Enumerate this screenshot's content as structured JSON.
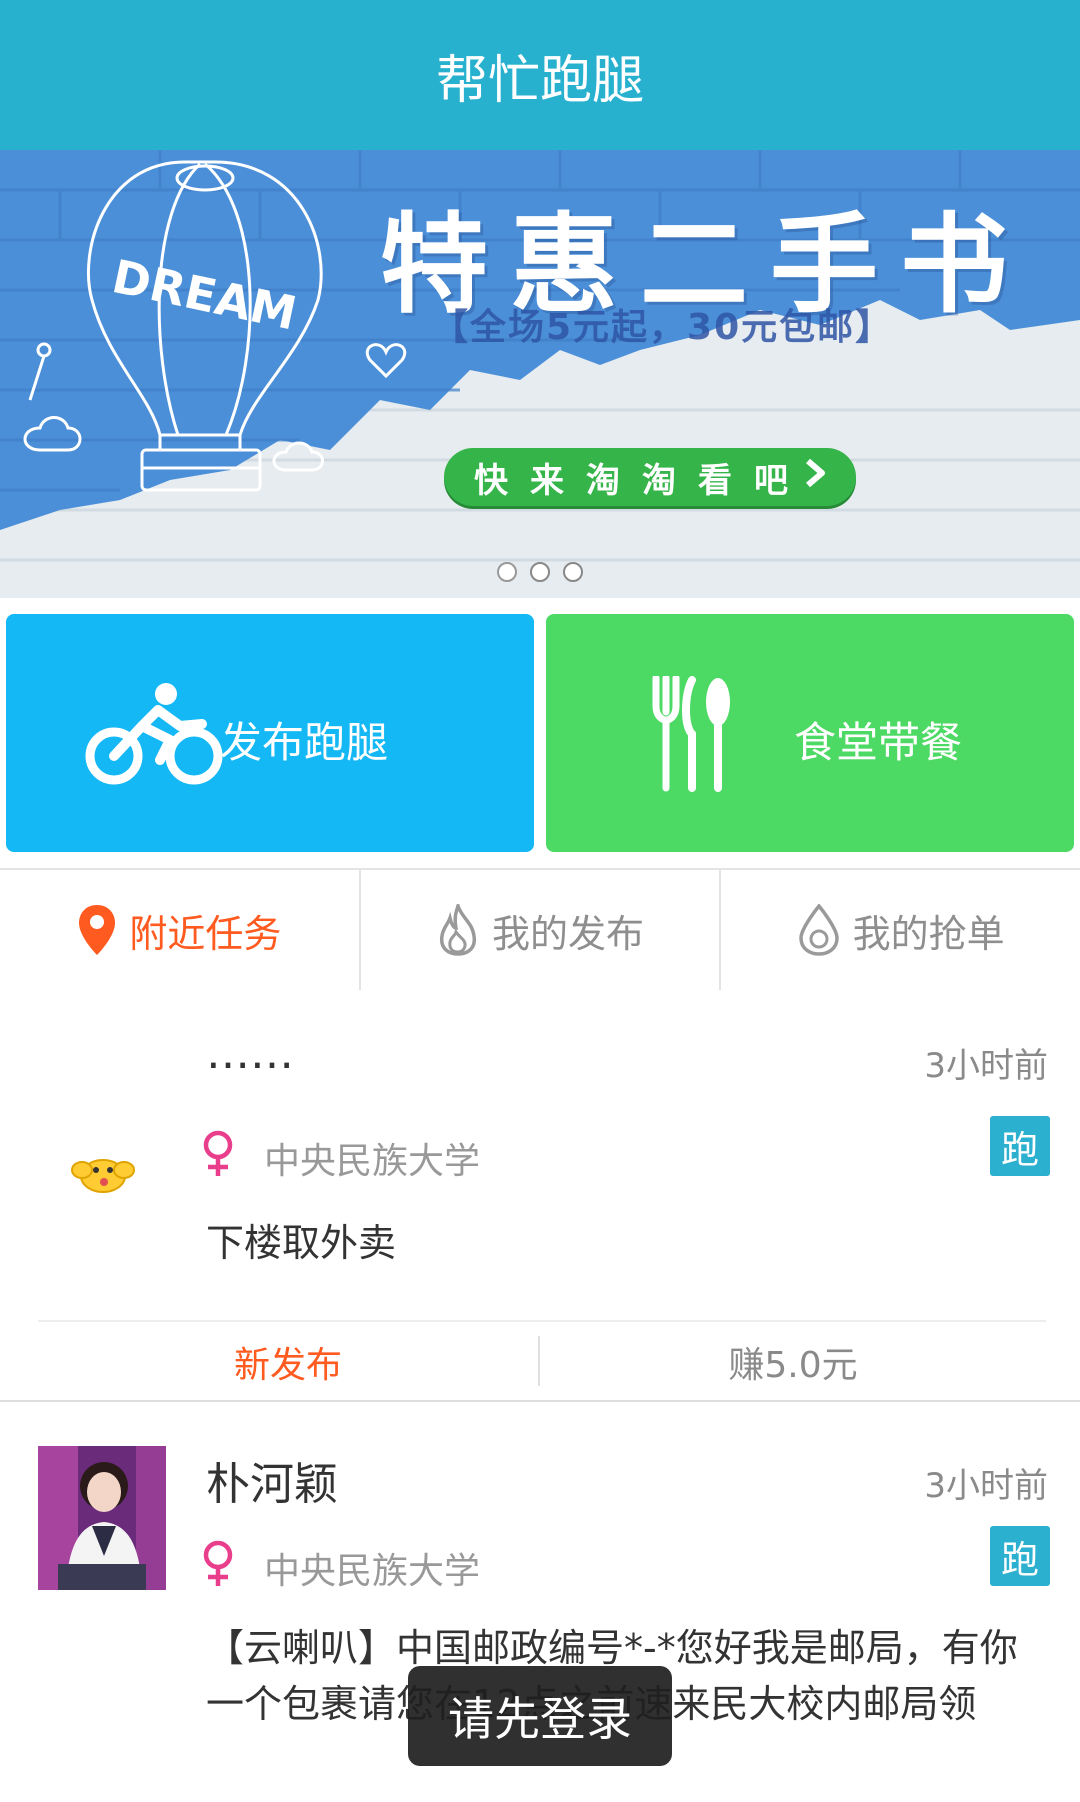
{
  "header": {
    "title": "帮忙跑腿"
  },
  "banner": {
    "title": "特惠二手书",
    "subtitle": "【全场5元起，30元包邮】",
    "cta": "快来淘淘看吧",
    "balloon_text": "DREAM",
    "page_count": 3,
    "active_page": 1
  },
  "actions": {
    "errand": {
      "label": "发布跑腿",
      "icon": "bicycle-icon",
      "color": "#14b8f4"
    },
    "canteen": {
      "label": "食堂带餐",
      "icon": "cutlery-icon",
      "color": "#4cd964"
    }
  },
  "tabs": [
    {
      "label": "附近任务",
      "icon": "location-pin-icon",
      "active": true
    },
    {
      "label": "我的发布",
      "icon": "flame-icon",
      "active": false
    },
    {
      "label": "我的抢单",
      "icon": "drop-icon",
      "active": false
    }
  ],
  "tasks": [
    {
      "name": "……",
      "time": "3小时前",
      "gender_icon": "female-icon",
      "school": "中央民族大学",
      "badge": "跑",
      "description": "下楼取外卖",
      "status": "新发布",
      "reward": "赚5.0元"
    },
    {
      "name": "朴河颖",
      "time": "3小时前",
      "gender_icon": "female-icon",
      "school": "中央民族大学",
      "badge": "跑",
      "description": "【云喇叭】中国邮政编号*-*您好我是邮局，有你一个包裹请您在12点之前速来民大校内邮局领"
    }
  ],
  "toast": {
    "message": "请先登录"
  },
  "colors": {
    "header": "#27b1cf",
    "accent_orange": "#ff5a1f",
    "badge": "#2cb0cf",
    "female": "#e83e8c"
  }
}
